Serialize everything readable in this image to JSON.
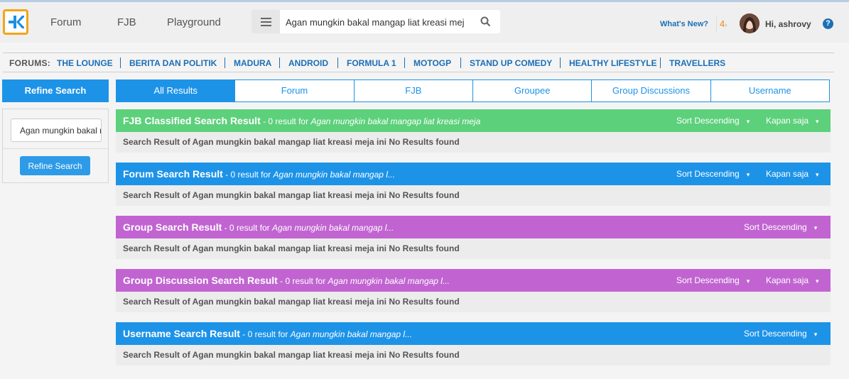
{
  "header": {
    "nav": [
      "Forum",
      "FJB",
      "Playground"
    ],
    "search": {
      "value": "Agan mungkin bakal mangap liat kreasi meja ini",
      "placeholder": ""
    },
    "whats_new": "What's New?",
    "notif_count": "4",
    "user_greeting": "Hi, ashrovy",
    "help": "?"
  },
  "forums_bar": {
    "label": "FORUMS:",
    "items": [
      "THE LOUNGE",
      "BERITA DAN POLITIK",
      "MADURA",
      "ANDROID",
      "FORMULA 1",
      "MOTOGP",
      "STAND UP COMEDY",
      "HEALTHY LIFESTYLE",
      "TRAVELLERS"
    ]
  },
  "sidebar": {
    "title": "Refine Search",
    "input_value": "Agan mungkin bakal mangap liat kreasi meja ini",
    "button": "Refine Search"
  },
  "tabs": [
    "All Results",
    "Forum",
    "FJB",
    "Groupee",
    "Group Discussions",
    "Username"
  ],
  "results": [
    {
      "title": "FJB Classified Search Result",
      "meta_prefix": " - 0 result for ",
      "meta_query": "Agan mungkin bakal mangap liat kreasi meja",
      "sort": "Sort Descending",
      "time": "Kapan saja",
      "body": "Search Result of Agan mungkin bakal mangap liat kreasi meja ini No Results found",
      "color": "#5dd07b"
    },
    {
      "title": "Forum Search Result",
      "meta_prefix": " - 0 result for ",
      "meta_query": "Agan mungkin bakal mangap l...",
      "sort": "Sort Descending",
      "time": "Kapan saja",
      "body": "Search Result of Agan mungkin bakal mangap liat kreasi meja ini No Results found",
      "color": "#1d93e8"
    },
    {
      "title": "Group Search Result",
      "meta_prefix": " - 0 result for ",
      "meta_query": "Agan mungkin bakal mangap l...",
      "sort": "Sort Descending",
      "time": "",
      "body": "Search Result of Agan mungkin bakal mangap liat kreasi meja ini No Results found",
      "color": "#c164d1"
    },
    {
      "title": "Group Discussion Search Result",
      "meta_prefix": " - 0 result for ",
      "meta_query": "Agan mungkin bakal mangap l...",
      "sort": "Sort Descending",
      "time": "Kapan saja",
      "body": "Search Result of Agan mungkin bakal mangap liat kreasi meja ini No Results found",
      "color": "#c164d1"
    },
    {
      "title": "Username Search Result",
      "meta_prefix": " - 0 result for ",
      "meta_query": "Agan mungkin bakal mangap l...",
      "sort": "Sort Descending",
      "time": "",
      "body": "Search Result of Agan mungkin bakal mangap liat kreasi meja ini No Results found",
      "color": "#1d93e8"
    }
  ]
}
